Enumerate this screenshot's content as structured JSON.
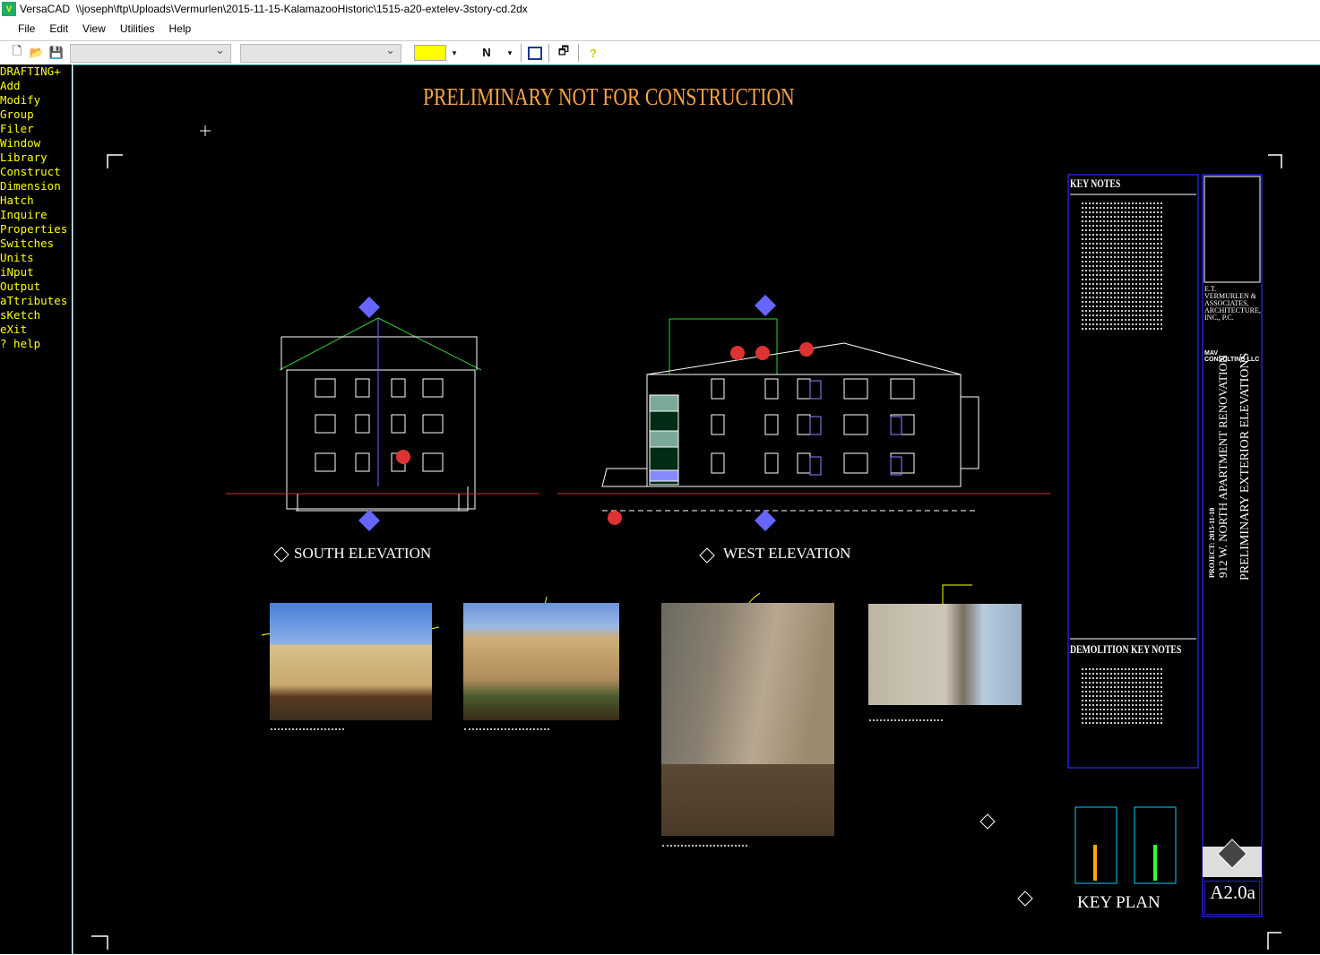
{
  "window": {
    "app": "VersaCAD",
    "path": "\\\\joseph\\ftp\\Uploads\\Vermurlen\\2015-11-15-KalamazooHistoric\\1515-a20-extelev-3story-cd.2dx"
  },
  "menu": [
    "File",
    "Edit",
    "View",
    "Utilities",
    "Help"
  ],
  "toolbar": {
    "layer_combo": "",
    "pen_combo": "",
    "color": "#ffff00",
    "line_style": "N",
    "icons": [
      "new-file-icon",
      "open-folder-icon",
      "save-icon",
      "layout-icon",
      "properties-icon",
      "help-icon"
    ]
  },
  "sidebar": {
    "items": [
      "DRAFTING+",
      "Add",
      "Modify",
      "Group",
      "Filer",
      "Window",
      "Library",
      "Construct",
      "Dimension",
      "Hatch",
      "Inquire",
      "Properties",
      "Switches",
      "Units",
      "iNput",
      "Output",
      "aTtributes",
      "sKetch",
      "eXit",
      "? help"
    ]
  },
  "drawing": {
    "banner": "PRELIMINARY NOT FOR CONSTRUCTION",
    "south_label": "SOUTH ELEVATION",
    "west_label": "WEST ELEVATION",
    "key_notes_title": "KEY NOTES",
    "demolition_title": "DEMOLITION KEY NOTES",
    "key_plan": "KEY PLAN",
    "firm": "E.T. VERMURLEN & ASSOCIATES, ARCHITECTURE, INC., P.C.",
    "consultant": "MAV CONSULTING LLC",
    "project": "PROJECT: 2015-11-10",
    "project_name": "912 W. NORTH APARTMENT RENOVATION",
    "sheet_title": "PRELIMINARY EXTERIOR ELEVATIONS",
    "sheet_number": "A2.0a"
  }
}
